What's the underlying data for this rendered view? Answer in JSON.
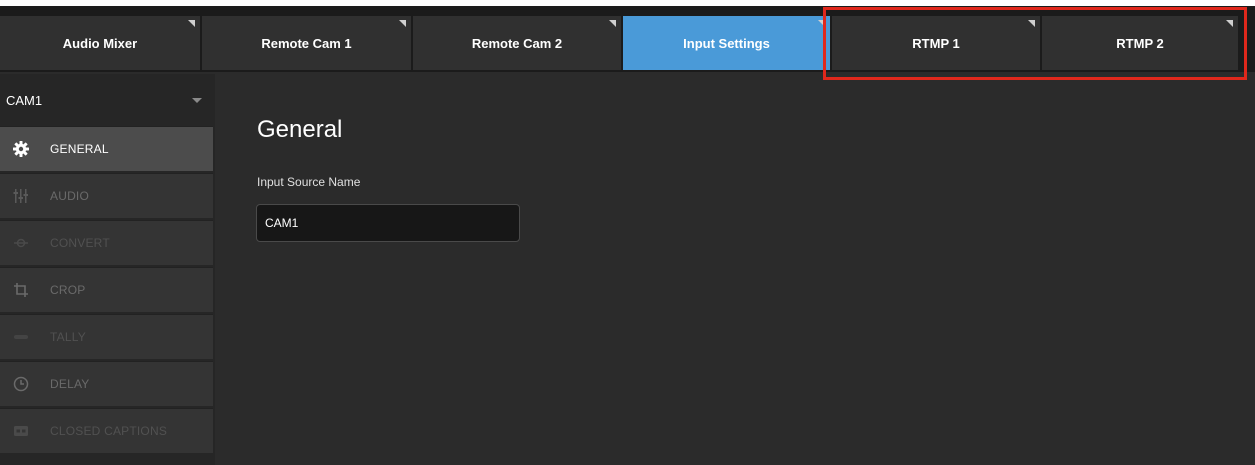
{
  "tabs": [
    {
      "label": "Audio Mixer",
      "active": false
    },
    {
      "label": "Remote Cam 1",
      "active": false
    },
    {
      "label": "Remote Cam 2",
      "active": false
    },
    {
      "label": "Input Settings",
      "active": true
    },
    {
      "label": "RTMP 1",
      "active": false
    },
    {
      "label": "RTMP 2",
      "active": false
    }
  ],
  "sidebar": {
    "source": "CAM1",
    "items": [
      {
        "label": "GENERAL",
        "icon": "gear-icon",
        "state": "active"
      },
      {
        "label": "AUDIO",
        "icon": "sliders-icon",
        "state": "normal"
      },
      {
        "label": "CONVERT",
        "icon": "convert-icon",
        "state": "dim"
      },
      {
        "label": "CROP",
        "icon": "crop-icon",
        "state": "normal"
      },
      {
        "label": "TALLY",
        "icon": "tally-icon",
        "state": "dim"
      },
      {
        "label": "DELAY",
        "icon": "clock-icon",
        "state": "normal"
      },
      {
        "label": "CLOSED CAPTIONS",
        "icon": "cc-icon",
        "state": "dim"
      }
    ]
  },
  "main": {
    "title": "General",
    "input_source_label": "Input Source Name",
    "input_source_value": "CAM1"
  },
  "colors": {
    "active_tab": "#4a9ad8",
    "highlight_box": "#e0281c",
    "background": "#2b2b2b"
  }
}
